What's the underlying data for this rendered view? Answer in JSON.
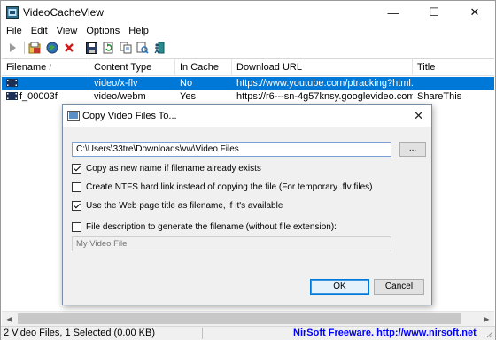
{
  "window": {
    "title": "VideoCacheView",
    "controls": {
      "minimize": "—",
      "maximize": "☐",
      "close": "✕"
    }
  },
  "menu": [
    "File",
    "Edit",
    "View",
    "Options",
    "Help"
  ],
  "toolbar": {
    "buttons": [
      "play-icon",
      "open-icon",
      "web-icon",
      "delete-icon",
      "save-icon",
      "refresh-icon",
      "copy-icon",
      "properties-icon",
      "exit-icon"
    ]
  },
  "list": {
    "columns": [
      "Filename",
      "Content Type",
      "In Cache",
      "Download URL",
      "Title"
    ],
    "sort_indicator": "/",
    "rows": [
      {
        "filename": "",
        "content_type": "video/x-flv",
        "in_cache": "No",
        "url": "https://www.youtube.com/ptracking?html...",
        "title": "",
        "selected": true
      },
      {
        "filename": "f_00003f",
        "content_type": "video/webm",
        "in_cache": "Yes",
        "url": "https://r6---sn-4g57knsy.googlevideo.com...",
        "title": "ShareThis",
        "selected": false
      }
    ]
  },
  "dialog": {
    "title": "Copy Video Files To...",
    "close": "✕",
    "path_value": "C:\\Users\\33tre\\Downloads\\vw\\Video Files",
    "browse_label": "...",
    "options": [
      {
        "label": "Copy as new name if filename already exists",
        "checked": true
      },
      {
        "label": "Create NTFS hard link instead of copying the file (For temporary .flv files)",
        "checked": false
      },
      {
        "label": "Use the Web page title as filename, if it's available",
        "checked": true
      },
      {
        "label": "File description to generate the filename (without file extension):",
        "checked": false
      }
    ],
    "description_placeholder": "My Video File",
    "ok_label": "OK",
    "cancel_label": "Cancel"
  },
  "scrollbar": {
    "left": "◀",
    "right": "▶"
  },
  "status": {
    "summary": "2 Video Files, 1 Selected  (0.00 KB)",
    "link": "NirSoft Freeware.  http://www.nirsoft.net"
  }
}
